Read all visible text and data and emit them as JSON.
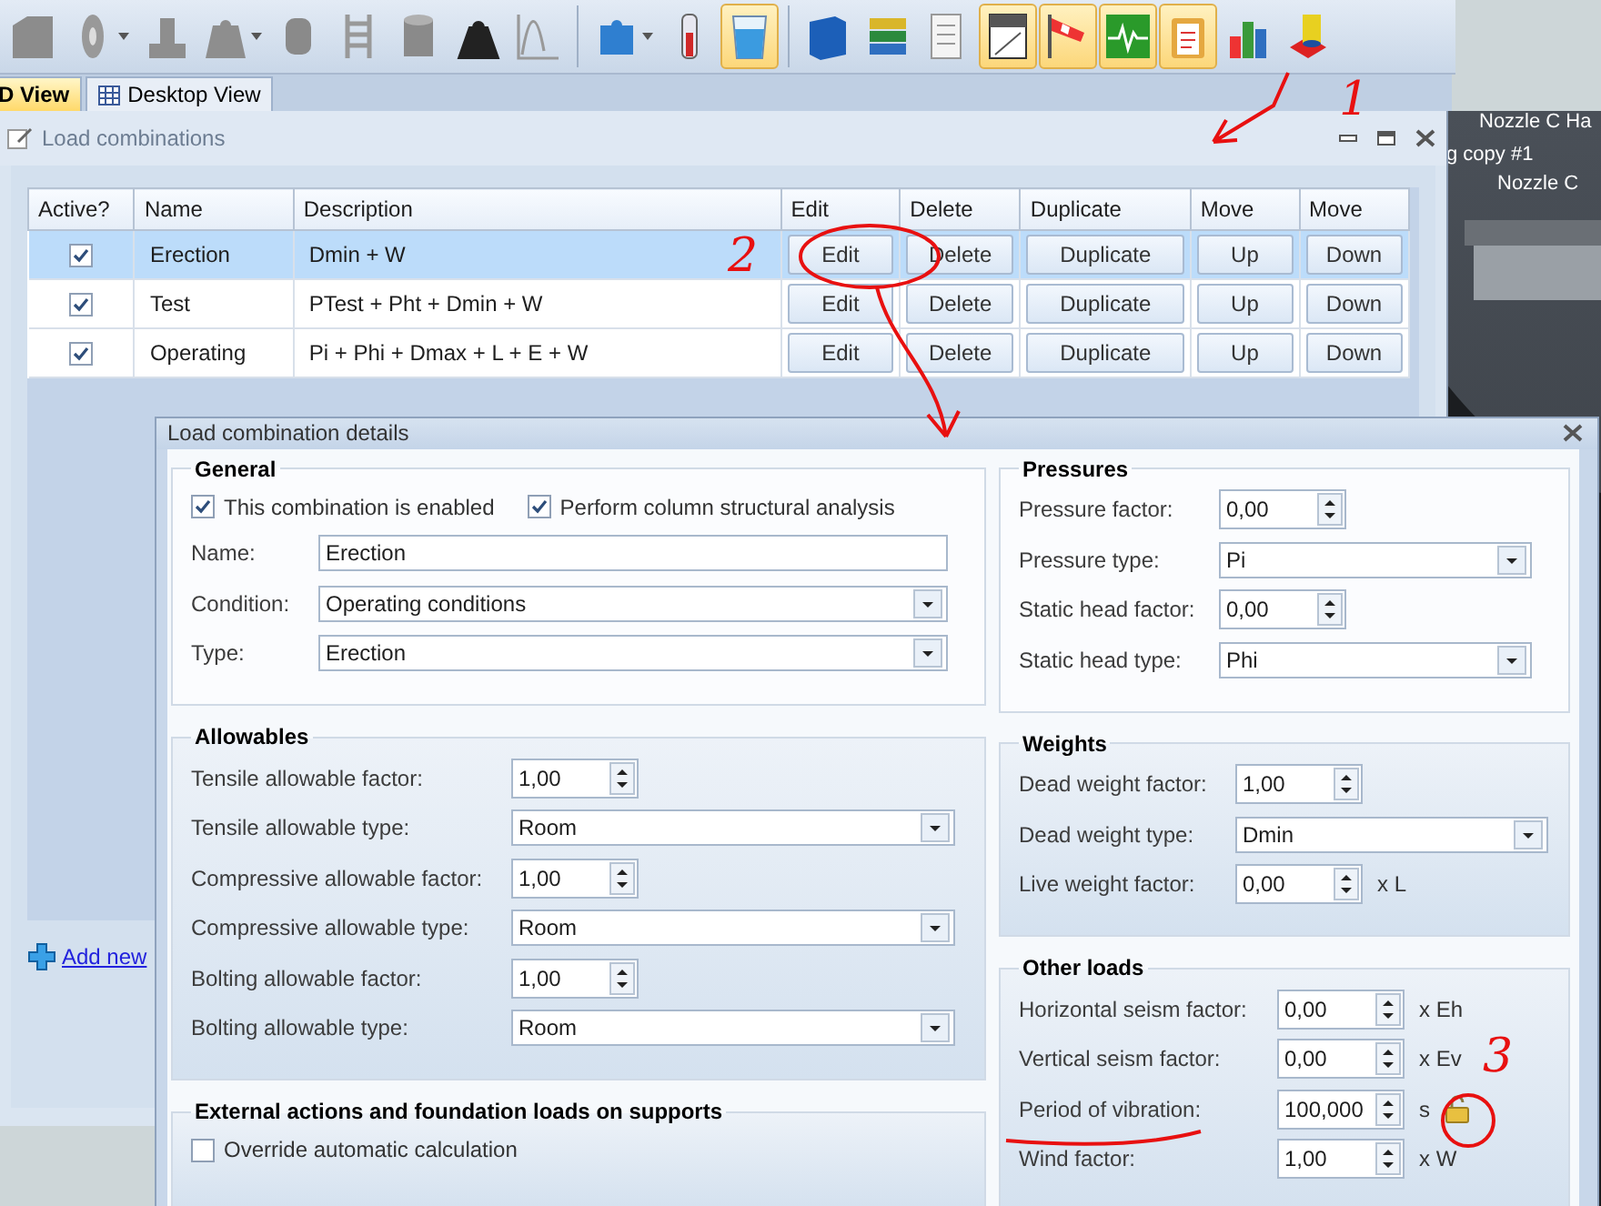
{
  "toolbar": {
    "buttons": [
      {
        "selected": false,
        "dropdown": false
      },
      {
        "selected": false,
        "dropdown": true
      },
      {
        "selected": false,
        "dropdown": false
      },
      {
        "selected": false,
        "dropdown": true
      },
      {
        "selected": false,
        "dropdown": false
      },
      {
        "selected": false,
        "dropdown": false
      },
      {
        "selected": false,
        "dropdown": false
      },
      {
        "selected": false,
        "dropdown": false
      },
      {
        "selected": false,
        "dropdown": false
      },
      {
        "selected": false,
        "dropdown": true
      },
      {
        "selected": false,
        "dropdown": false
      },
      {
        "selected": true,
        "dropdown": false
      },
      {
        "selected": false,
        "dropdown": false
      },
      {
        "selected": false,
        "dropdown": false
      },
      {
        "selected": false,
        "dropdown": false
      },
      {
        "selected": true,
        "dropdown": false
      },
      {
        "selected": true,
        "dropdown": false
      },
      {
        "selected": true,
        "dropdown": false
      },
      {
        "selected": true,
        "dropdown": false
      },
      {
        "selected": false,
        "dropdown": false
      },
      {
        "selected": false,
        "dropdown": false
      }
    ]
  },
  "view_tabs": [
    {
      "label": "D View",
      "selected": true
    },
    {
      "label": "Desktop View",
      "selected": false
    }
  ],
  "scene_labels": [
    "Nozzle C Ha",
    "g copy #1",
    "Nozzle C"
  ],
  "load_combinations": {
    "title": "Load combinations",
    "columns": [
      "Active?",
      "Name",
      "Description",
      "Edit",
      "Delete",
      "Duplicate",
      "Move",
      "Move"
    ],
    "rows": [
      {
        "active": true,
        "selected": true,
        "name": "Erection",
        "description": "Dmin + W",
        "actions": [
          "Edit",
          "Delete",
          "Duplicate",
          "Up",
          "Down"
        ]
      },
      {
        "active": true,
        "selected": false,
        "name": "Test",
        "description": "PTest + Pht + Dmin + W",
        "actions": [
          "Edit",
          "Delete",
          "Duplicate",
          "Up",
          "Down"
        ]
      },
      {
        "active": true,
        "selected": false,
        "name": "Operating",
        "description": "Pi + Phi + Dmax + L + E  + W",
        "actions": [
          "Edit",
          "Delete",
          "Duplicate",
          "Up",
          "Down"
        ]
      }
    ],
    "add_link": "Add new"
  },
  "details": {
    "title": "Load combination details",
    "left_groups": [
      {
        "title": "General",
        "checkboxes": [
          {
            "label": "This combination is enabled",
            "checked": true
          },
          {
            "label": "Perform column structural analysis",
            "checked": true
          }
        ],
        "fields": [
          {
            "label": "Name:",
            "kind": "text",
            "value": "Erection"
          },
          {
            "label": "Condition:",
            "kind": "select",
            "value": "Operating conditions"
          },
          {
            "label": "Type:",
            "kind": "select",
            "value": "Erection"
          }
        ]
      },
      {
        "title": "Allowables",
        "fields": [
          {
            "label": "Tensile allowable factor:",
            "kind": "spinner",
            "value": "1,00"
          },
          {
            "label": "Tensile allowable type:",
            "kind": "select",
            "value": "Room"
          },
          {
            "label": "Compressive allowable factor:",
            "kind": "spinner",
            "value": "1,00"
          },
          {
            "label": "Compressive allowable type:",
            "kind": "select",
            "value": "Room"
          },
          {
            "label": "Bolting allowable factor:",
            "kind": "spinner",
            "value": "1,00"
          },
          {
            "label": "Bolting allowable type:",
            "kind": "select",
            "value": "Room"
          }
        ]
      },
      {
        "title": "External actions and foundation loads on supports",
        "checkboxes": [
          {
            "label": "Override automatic calculation",
            "checked": false
          }
        ]
      }
    ],
    "right_groups": [
      {
        "title": "Pressures",
        "fields": [
          {
            "label": "Pressure factor:",
            "kind": "spinner",
            "value": "0,00"
          },
          {
            "label": "Pressure type:",
            "kind": "select",
            "value": "Pi"
          },
          {
            "label": "Static head factor:",
            "kind": "spinner",
            "value": "0,00"
          },
          {
            "label": "Static head type:",
            "kind": "select",
            "value": "Phi"
          }
        ]
      },
      {
        "title": "Weights",
        "fields": [
          {
            "label": "Dead weight factor:",
            "kind": "spinner",
            "value": "1,00"
          },
          {
            "label": "Dead weight type:",
            "kind": "select",
            "value": "Dmin"
          },
          {
            "label": "Live weight factor:",
            "kind": "spinner",
            "value": "0,00",
            "unit": "x L"
          }
        ]
      },
      {
        "title": "Other loads",
        "fields": [
          {
            "label": "Horizontal seism factor:",
            "kind": "spinner",
            "value": "0,00",
            "unit": "x Eh"
          },
          {
            "label": "Vertical seism factor:",
            "kind": "spinner",
            "value": "0,00",
            "unit": "x Ev"
          },
          {
            "label": "Period of vibration:",
            "kind": "spinner",
            "value": "100,000",
            "unit": "s",
            "locked": true
          },
          {
            "label": "Wind factor:",
            "kind": "spinner",
            "value": "1,00",
            "unit": "x W"
          }
        ]
      }
    ]
  },
  "annotations": [
    "1",
    "2",
    "3"
  ]
}
